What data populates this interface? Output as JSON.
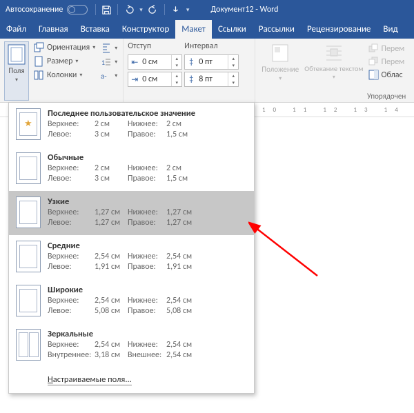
{
  "title": {
    "autosave": "Автосохранение",
    "doc": "Документ12  -  Word"
  },
  "tabs": [
    "Файл",
    "Главная",
    "Вставка",
    "Конструктор",
    "Макет",
    "Ссылки",
    "Рассылки",
    "Рецензирование",
    "Вид"
  ],
  "ribbon": {
    "margins": "Поля",
    "orientation": "Ориентация",
    "size": "Размер",
    "columns": "Колонки",
    "indent_label": "Отступ",
    "spacing_label": "Интервал",
    "indent_left": "0 см",
    "indent_right": "0 см",
    "spacing_before": "0 пт",
    "spacing_after": "8 пт",
    "position": "Положение",
    "wrap": "Обтекание текстом",
    "move1": "Перем",
    "move2": "Перем",
    "selpane": "Облас",
    "arrange": "Упорядочен"
  },
  "ruler": "10  11  12  13  14  1",
  "margins_menu": {
    "items": [
      {
        "name": "Последнее пользовательское значение",
        "top": "2 см",
        "bottom": "2 см",
        "left": "3 см",
        "right": "1,5 см",
        "lbl_left": "Левое:",
        "lbl_right": "Правое:",
        "star": true
      },
      {
        "name": "Обычные",
        "top": "2 см",
        "bottom": "2 см",
        "left": "3 см",
        "right": "1,5 см",
        "lbl_left": "Левое:",
        "lbl_right": "Правое:"
      },
      {
        "name": "Узкие",
        "top": "1,27 см",
        "bottom": "1,27 см",
        "left": "1,27 см",
        "right": "1,27 см",
        "lbl_left": "Левое:",
        "lbl_right": "Правое:",
        "selected": true
      },
      {
        "name": "Средние",
        "top": "2,54 см",
        "bottom": "2,54 см",
        "left": "1,91 см",
        "right": "1,91 см",
        "lbl_left": "Левое:",
        "lbl_right": "Правое:"
      },
      {
        "name": "Широкие",
        "top": "2,54 см",
        "bottom": "2,54 см",
        "left": "5,08 см",
        "right": "5,08 см",
        "lbl_left": "Левое:",
        "lbl_right": "Правое:"
      },
      {
        "name": "Зеркальные",
        "top": "2,54 см",
        "bottom": "2,54 см",
        "left": "3,18 см",
        "right": "2,54 см",
        "lbl_left": "Внутреннее:",
        "lbl_right": "Внешнее:",
        "mirror": true
      }
    ],
    "labels": {
      "top": "Верхнее:",
      "bottom": "Нижнее:"
    },
    "custom": "Настраиваемые поля..."
  }
}
